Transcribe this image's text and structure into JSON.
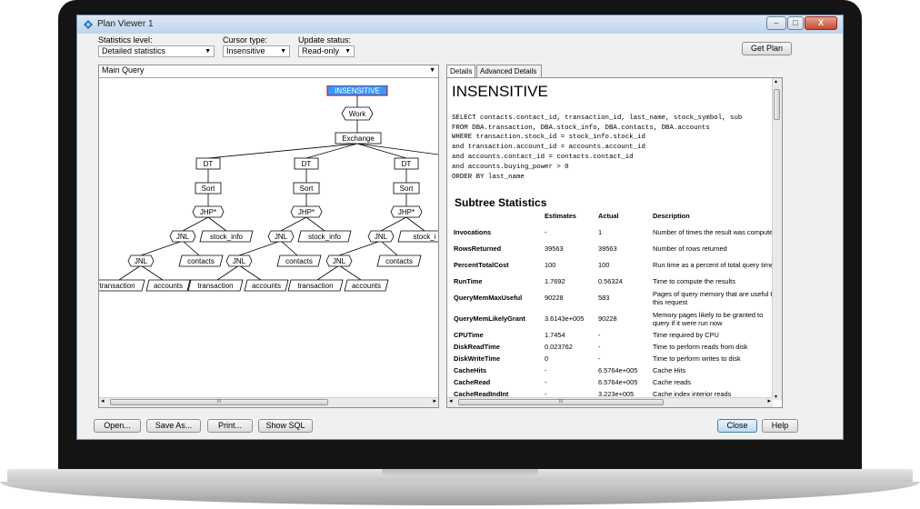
{
  "window": {
    "title": "Plan Viewer 1",
    "controls": {
      "minimize": "–",
      "maximize": "□",
      "close": "X"
    }
  },
  "toolbar": {
    "statistics_level": {
      "label": "Statistics level:",
      "value": "Detailed statistics"
    },
    "cursor_type": {
      "label": "Cursor type:",
      "value": "Insensitive"
    },
    "update_status": {
      "label": "Update status:",
      "value": "Read-only"
    },
    "get_plan": "Get Plan"
  },
  "query_selector": {
    "value": "Main Query"
  },
  "plan_tree": {
    "root": "INSENSITIVE",
    "work": "Work",
    "exchange": "Exchange",
    "branch": {
      "dt": "DT",
      "sort": "Sort",
      "jhp": "JHP*",
      "jnl": "JNL",
      "stock_info": "stock_info",
      "contacts": "contacts",
      "transaction": "transaction",
      "accounts": "accounts"
    },
    "cut_labels": {
      "stock_info": "stock_i",
      "transaction": "transa"
    }
  },
  "tabs": [
    "Details",
    "Advanced Details"
  ],
  "details": {
    "title": "INSENSITIVE",
    "sql": [
      "SELECT contacts.contact_id, transaction_id, last_name, stock_symbol, sub",
      "FROM DBA.transaction, DBA.stock_info, DBA.contacts, DBA.accounts",
      "WHERE transaction.stock_id = stock_info.stock_id",
      "and transaction.account_id = accounts.account_id",
      "and accounts.contact_id = contacts.contact_id",
      "and accounts.buying_power > 0",
      "ORDER BY last_name"
    ],
    "subtree_heading": "Subtree Statistics",
    "columns": [
      "",
      "Estimates",
      "Actual",
      "Description"
    ],
    "rows": [
      [
        "Invocations",
        "-",
        "1",
        "Number of times the result was computed"
      ],
      [
        "RowsReturned",
        "39563",
        "39563",
        "Number of rows returned"
      ],
      [
        "PercentTotalCost",
        "100",
        "100",
        "Run time as a percent of total query time"
      ],
      [
        "RunTime",
        "1.7692",
        "0.56324",
        "Time to compute the results"
      ],
      [
        "QueryMemMaxUseful",
        "90228",
        "583",
        "Pages of query memory that are useful to this request"
      ],
      [
        "QueryMemLikelyGrant",
        "3.6143e+005",
        "90228",
        "Memory pages likely to be granted to query if it were run now"
      ],
      [
        "CPUTime",
        "1.7454",
        "-",
        "Time required by CPU"
      ],
      [
        "DiskReadTime",
        "0.023762",
        "-",
        "Time to perform reads from disk"
      ],
      [
        "DiskWriteTime",
        "0",
        "-",
        "Time to perform writes to disk"
      ],
      [
        "CacheHits",
        "-",
        "6.5764e+005",
        "Cache Hits"
      ],
      [
        "CacheRead",
        "-",
        "6.5764e+005",
        "Cache reads"
      ],
      [
        "CacheReadIndInt",
        "-",
        "3.223e+005",
        "Cache index interior reads"
      ]
    ]
  },
  "footer": {
    "open": "Open...",
    "save_as": "Save As...",
    "print": "Print...",
    "show_sql": "Show SQL",
    "close": "Close",
    "help": "Help"
  },
  "scroll_thumb_mark": "III",
  "colors": {
    "root_node_fill": "#3399ff",
    "root_node_border": "#cc0000",
    "titlebar": "#bfd3ec"
  }
}
